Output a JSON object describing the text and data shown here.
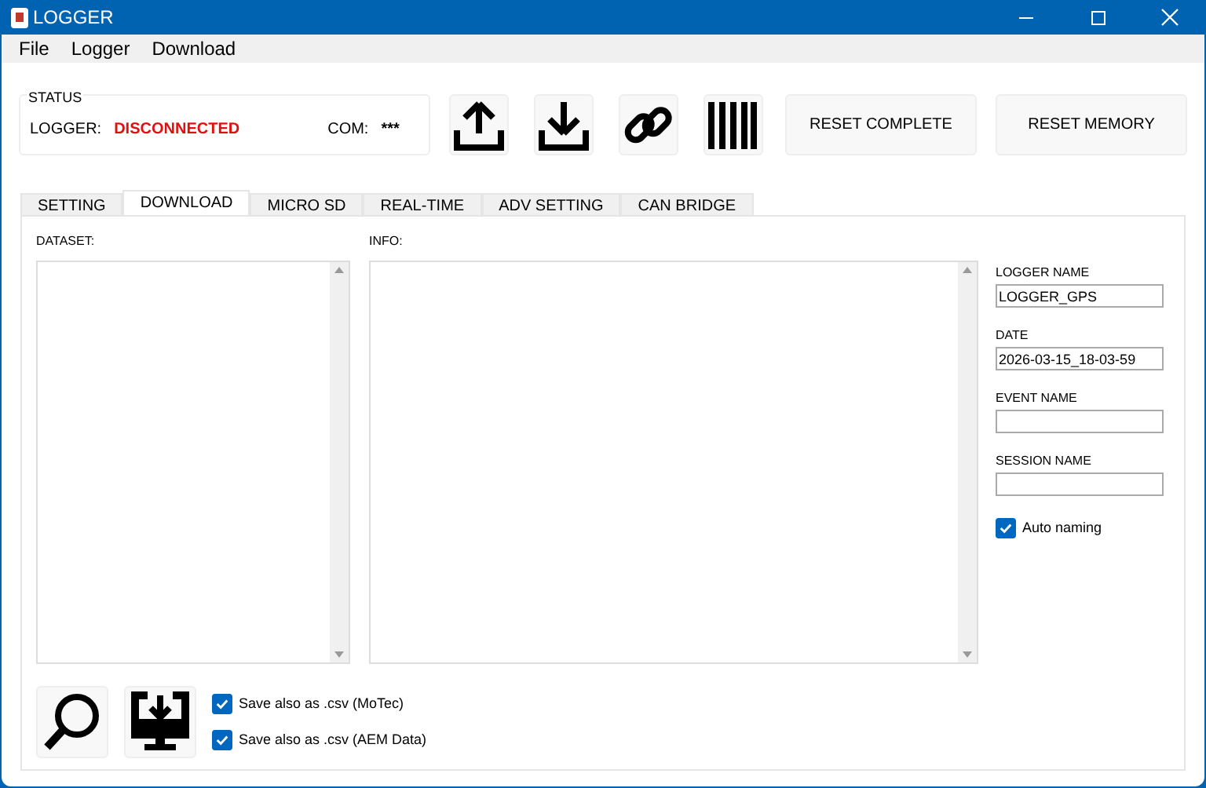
{
  "window": {
    "title": "LOGGER"
  },
  "menu": [
    "File",
    "Logger",
    "Download"
  ],
  "status": {
    "title": "STATUS",
    "logger_label": "LOGGER:",
    "logger_value": "DISCONNECTED",
    "com_label": "COM:",
    "com_value": "***"
  },
  "toolbar": [
    {
      "kind": "upload"
    },
    {
      "kind": "download"
    },
    {
      "kind": "link"
    },
    {
      "kind": "barcode"
    }
  ],
  "buttons": [
    "RESET COMPLETE",
    "RESET MEMORY"
  ],
  "tabs": [
    {
      "label": "SETTING",
      "selected": false
    },
    {
      "label": "DOWNLOAD",
      "selected": true
    },
    {
      "label": "MICRO SD",
      "selected": false
    },
    {
      "label": "REAL-TIME",
      "selected": false
    },
    {
      "label": "ADV SETTING",
      "selected": false
    },
    {
      "label": "CAN BRIDGE",
      "selected": false
    }
  ],
  "dataset_label": "DATASET:",
  "info_label": "INFO:",
  "fields": [
    {
      "label": "LOGGER NAME",
      "value": "LOGGER_GPS"
    },
    {
      "label": "DATE",
      "value": "2026-03-15_18-03-59"
    },
    {
      "label": "EVENT NAME"
    },
    {
      "label": "SESSION NAME"
    }
  ],
  "auto_naming": {
    "label": "Auto naming",
    "checked": true
  },
  "bottom_tools": [
    {
      "kind": "search"
    },
    {
      "kind": "monitor-download"
    }
  ],
  "options": [
    {
      "label": "Save also as .csv (MoTec)",
      "checked": true
    },
    {
      "label": "Save also as .csv (AEM Data)",
      "checked": true
    }
  ]
}
